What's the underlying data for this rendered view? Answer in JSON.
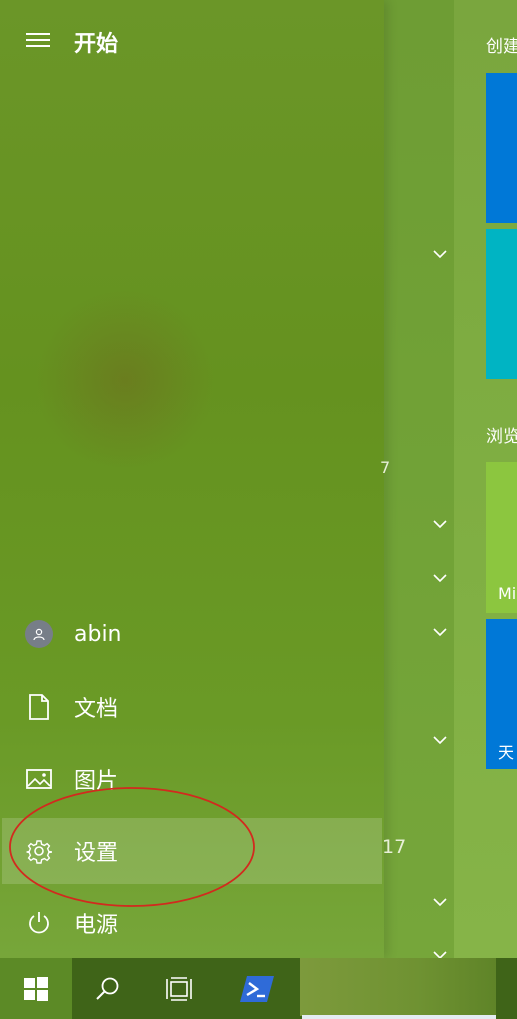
{
  "header": {
    "title": "开始"
  },
  "nav": {
    "user": "abin",
    "documents": "文档",
    "pictures": "图片",
    "settings": "设置",
    "power": "电源"
  },
  "tiles_area": {
    "section_create": "创建",
    "section_browse": "浏览",
    "tile_mi_label": "Mi",
    "tile_tian_label": "天",
    "fragment_7": "7",
    "fragment_17": "17"
  },
  "colors": {
    "accent_blue": "#0078d7",
    "teal": "#00b4c3",
    "lime": "#8cc63f",
    "annotation_red": "#d22a1e"
  },
  "icons": {
    "menu": "hamburger-icon",
    "user": "person-icon",
    "documents": "document-icon",
    "pictures": "picture-icon",
    "settings": "gear-icon",
    "power": "power-icon",
    "start": "windows-icon",
    "search": "search-icon",
    "task_view": "task-view-icon",
    "powershell": "powershell-icon"
  }
}
